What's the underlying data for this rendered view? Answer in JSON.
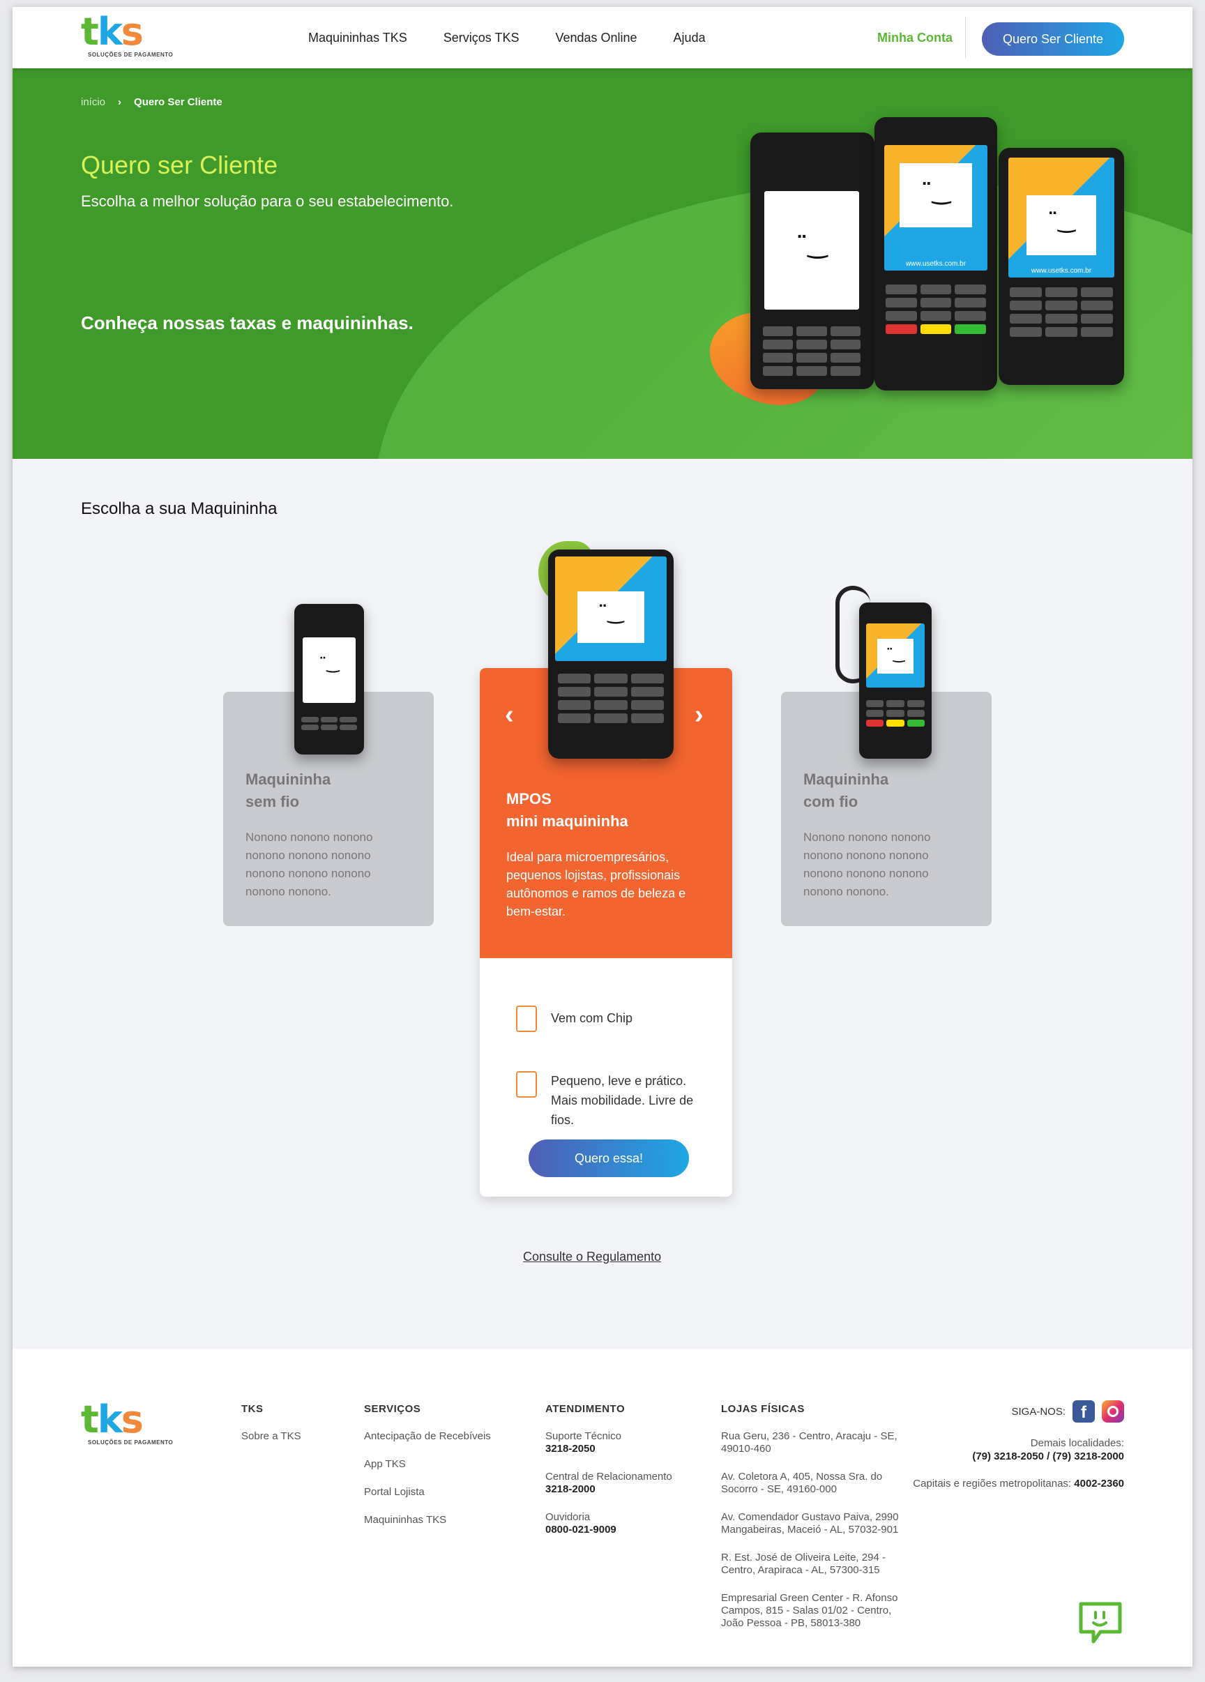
{
  "header": {
    "logo_text": "tks",
    "logo_sub": "SOLUÇÕES DE PAGAMENTO",
    "nav": [
      "Maquininhas TKS",
      "Serviços TKS",
      "Vendas Online",
      "Ajuda"
    ],
    "account": "Minha Conta",
    "cta": "Quero Ser Cliente"
  },
  "hero": {
    "breadcrumb": [
      "início",
      "Quero Ser Cliente"
    ],
    "title": "Quero ser Cliente",
    "lead": "Escolha a melhor solução para o seu estabelecimento.",
    "cta": "Conheça nossas taxas e maquininhas."
  },
  "devices": {
    "url_1": "www.usetks.com.br",
    "url_2": "www.usetks.com.br"
  },
  "section": {
    "title": "Escolha a sua Maquininha",
    "left_card": {
      "title": "Maquininha\nsem fio",
      "desc": "Nonono nonono nonono nonono nonono nonono nonono nonono nonono nonono nonono."
    },
    "right_card": {
      "title": "Maquininha\ncom fio",
      "desc": "Nonono nonono nonono nonono nonono nonono nonono nonono nonono nonono nonono."
    },
    "main_card": {
      "title_1": "MPOS",
      "title_2": "mini maquininha",
      "desc": "Ideal para microempresários, pequenos lojistas, profissionais autônomos e ramos de beleza e bem-estar.",
      "feature_1": "Vem com Chip",
      "feature_2": "Pequeno, leve e prático. Mais mobilidade. Livre de fios.",
      "button": "Quero essa!"
    },
    "regulamento": "Consulte o Regulamento"
  },
  "footer": {
    "tks": {
      "heading": "TKS",
      "items": [
        "Sobre a TKS"
      ]
    },
    "servicos": {
      "heading": "SERVIÇOS",
      "items": [
        "Antecipação de Recebíveis",
        "App TKS",
        "Portal Lojista",
        "Maquininhas TKS"
      ]
    },
    "atendimento": {
      "heading": "ATENDIMENTO",
      "items": [
        {
          "label": "Suporte Técnico",
          "value": "3218-2050"
        },
        {
          "label": "Central de Relacionamento",
          "value": "3218-2000"
        },
        {
          "label": "Ouvidoria",
          "value": "0800-021-9009"
        }
      ]
    },
    "lojas": {
      "heading": "LOJAS FÍSICAS",
      "items": [
        "Rua Geru, 236 - Centro, Aracaju - SE, 49010-460",
        "Av. Coletora A, 405, Nossa Sra. do Socorro - SE, 49160-000",
        "Av. Comendador Gustavo Paiva, 2990 Mangabeiras, Maceió - AL, 57032-901",
        "R. Est. José de Oliveira Leite, 294 - Centro, Arapiraca - AL, 57300-315",
        "Empresarial Green Center - R. Afonso Campos, 815 - Salas 01/02 - Centro, João Pessoa - PB, 58013-380"
      ]
    },
    "social_label": "SIGA-NOS:",
    "contact_1_label": "Demais localidades:",
    "contact_1_value": "(79) 3218-2050 / (79) 3218-2000",
    "contact_2_label": "Capitais e regiões metropolitanas:",
    "contact_2_value": "4002-2360"
  },
  "colors": {
    "brand_green": "#3f9a2a",
    "accent_orange": "#f26430",
    "accent_lime": "#d8f25a",
    "button_blue": "#1ea7e4"
  }
}
